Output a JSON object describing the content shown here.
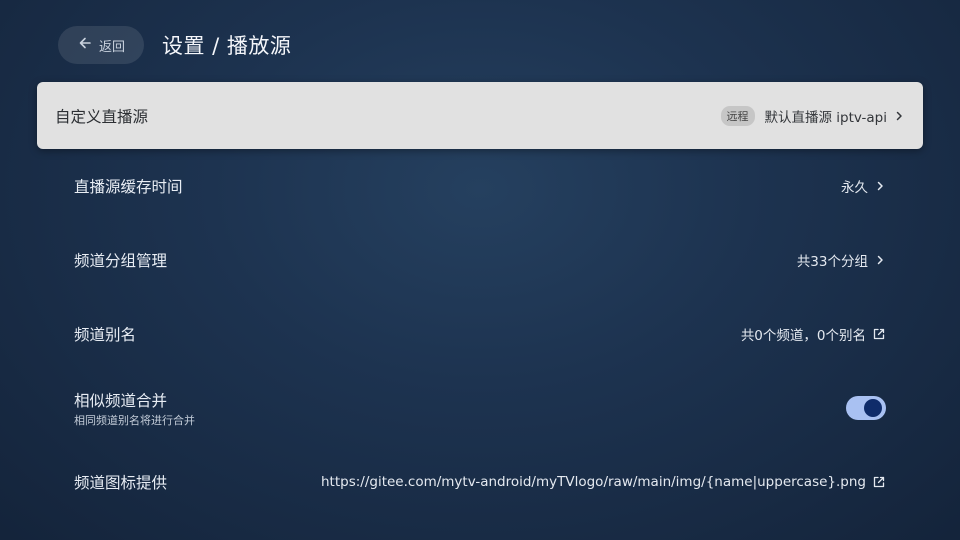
{
  "header": {
    "back_label": "返回",
    "title": "设置 / 播放源"
  },
  "rows": [
    {
      "label": "自定义直播源",
      "badge": "远程",
      "value": "默认直播源 iptv-api",
      "icon": "chevron-right-icon"
    },
    {
      "label": "直播源缓存时间",
      "value": "永久",
      "icon": "chevron-right-icon"
    },
    {
      "label": "频道分组管理",
      "value": "共33个分组",
      "icon": "chevron-right-icon"
    },
    {
      "label": "频道别名",
      "value": "共0个频道，0个别名",
      "icon": "external-link-icon"
    },
    {
      "label": "相似频道合并",
      "sublabel": "相同频道别名将进行合并",
      "toggle": true
    },
    {
      "label": "频道图标提供",
      "value": "https://gitee.com/mytv-android/myTVlogo/raw/main/img/{name|uppercase}.png",
      "icon": "external-link-icon"
    }
  ],
  "colors": {
    "focused_bg": "#e1e1e1",
    "toggle_track": "#a9c1f2",
    "toggle_knob": "#0f2c6a"
  }
}
